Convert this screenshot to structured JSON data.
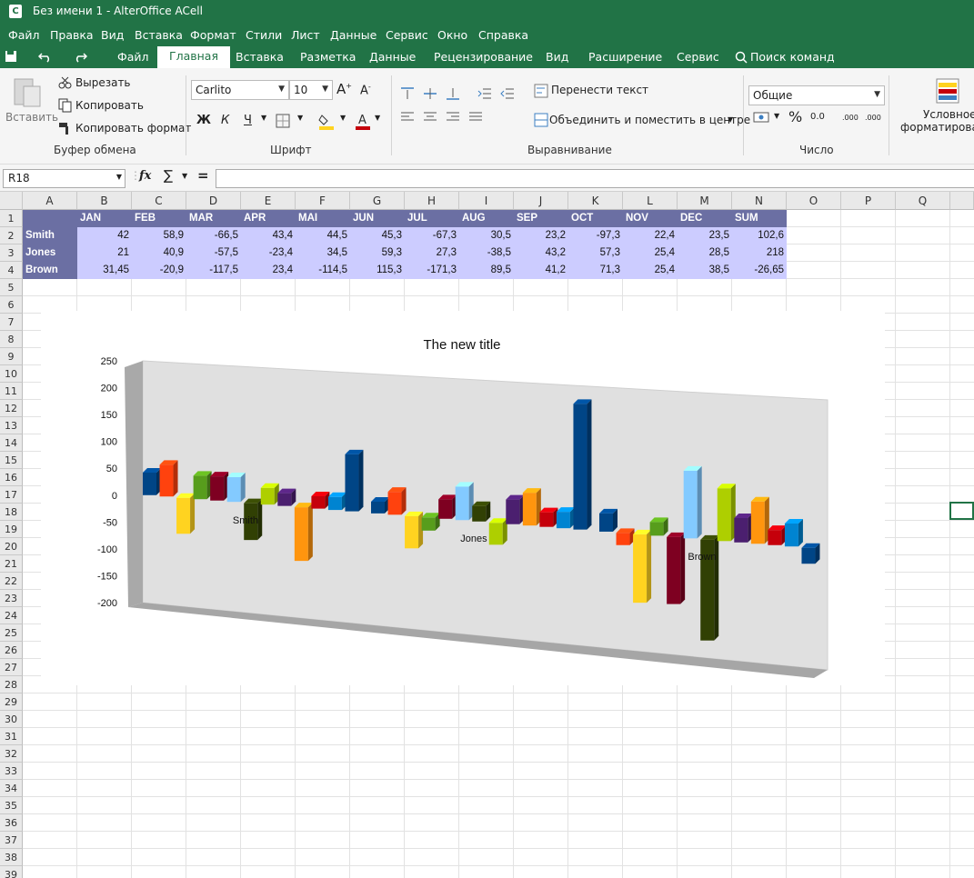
{
  "window": {
    "title": "Без имени 1 - AlterOffice ACell",
    "app_icon": "C"
  },
  "menu": [
    "Файл",
    "Правка",
    "Вид",
    "Вставка",
    "Формат",
    "Стили",
    "Лист",
    "Данные",
    "Сервис",
    "Окно",
    "Справка"
  ],
  "ribbon_tabs": [
    "Файл",
    "Главная",
    "Вставка",
    "Разметка",
    "Данные",
    "Рецензирование",
    "Вид",
    "Расширение",
    "Сервис"
  ],
  "active_tab": "Главная",
  "search_commands": "Поиск команд",
  "clipboard": {
    "paste": "Вставить",
    "cut": "Вырезать",
    "copy": "Копировать",
    "copy_format": "Копировать формат",
    "group": "Буфер обмена"
  },
  "font": {
    "name": "Carlito",
    "size": "10",
    "bold": "Ж",
    "italic": "К",
    "underline": "Ч",
    "group": "Шрифт"
  },
  "alignment": {
    "wrap": "Перенести текст",
    "merge": "Объединить и поместить в центре",
    "group": "Выравнивание"
  },
  "number": {
    "format": "Общие",
    "percent": "%",
    "decimal": "0.0",
    "inc_decimal": ".000",
    "dec_decimal": ".000",
    "group": "Число"
  },
  "conditional": {
    "line1": "Условное",
    "line2": "форматирован"
  },
  "name_box": "R18",
  "formula": "",
  "fx_label": "fx",
  "columns": [
    "A",
    "B",
    "C",
    "D",
    "E",
    "F",
    "G",
    "H",
    "I",
    "J",
    "K",
    "L",
    "M",
    "N",
    "O",
    "P",
    "Q"
  ],
  "rows": [
    "1",
    "2",
    "3",
    "4",
    "5",
    "6",
    "7",
    "8",
    "9",
    "10",
    "11",
    "12",
    "13",
    "14",
    "15",
    "16",
    "17",
    "18",
    "19",
    "20",
    "21",
    "22",
    "23",
    "24",
    "25",
    "26",
    "27",
    "28",
    "29",
    "30",
    "31",
    "32",
    "33",
    "34",
    "35",
    "36",
    "37",
    "38",
    "39"
  ],
  "table": {
    "headers": [
      "JAN",
      "FEB",
      "MAR",
      "APR",
      "MAI",
      "JUN",
      "JUL",
      "AUG",
      "SEP",
      "OCT",
      "NOV",
      "DEC",
      "SUM"
    ],
    "rows": [
      {
        "name": "Smith",
        "values": [
          "42",
          "58,9",
          "-66,5",
          "43,4",
          "44,5",
          "45,3",
          "-67,3",
          "30,5",
          "23,2",
          "-97,3",
          "22,4",
          "23,5",
          "102,6"
        ]
      },
      {
        "name": "Jones",
        "values": [
          "21",
          "40,9",
          "-57,5",
          "-23,4",
          "34,5",
          "59,3",
          "27,3",
          "-38,5",
          "43,2",
          "57,3",
          "25,4",
          "28,5",
          "218"
        ]
      },
      {
        "name": "Brown",
        "values": [
          "31,45",
          "-20,9",
          "-117,5",
          "23,4",
          "-114,5",
          "115,3",
          "-171,3",
          "89,5",
          "41,2",
          "71,3",
          "25,4",
          "38,5",
          "-26,65"
        ]
      }
    ],
    "header_color": "#6b6fa3",
    "value_color": "#ccccff"
  },
  "chart_data": {
    "type": "bar",
    "title": "The new title",
    "categories": [
      "Smith",
      "Jones",
      "Brown"
    ],
    "series": [
      {
        "values": [
          42,
          21,
          31.45
        ],
        "color": "#004586"
      },
      {
        "values": [
          58.9,
          40.9,
          -20.9
        ],
        "color": "#ff420e"
      },
      {
        "values": [
          -66.5,
          -57.5,
          -117.5
        ],
        "color": "#ffd320"
      },
      {
        "values": [
          43.4,
          -23.4,
          23.4
        ],
        "color": "#579d1c"
      },
      {
        "values": [
          44.5,
          34.5,
          -114.5
        ],
        "color": "#7e0021"
      },
      {
        "values": [
          45.3,
          59.3,
          115.3
        ],
        "color": "#83caff"
      },
      {
        "values": [
          -67.3,
          27.3,
          -171.3
        ],
        "color": "#314004"
      },
      {
        "values": [
          30.5,
          -38.5,
          89.5
        ],
        "color": "#aecf00"
      },
      {
        "values": [
          23.2,
          43.2,
          41.2
        ],
        "color": "#4b1f6f"
      },
      {
        "values": [
          -97.3,
          57.3,
          71.3
        ],
        "color": "#ff950e"
      },
      {
        "values": [
          22.4,
          25.4,
          25.4
        ],
        "color": "#c5000b"
      },
      {
        "values": [
          23.5,
          28.5,
          38.5
        ],
        "color": "#0084d1"
      },
      {
        "values": [
          102.6,
          218,
          -26.65
        ],
        "color": "#004586"
      }
    ],
    "y_ticks": [
      "250",
      "200",
      "150",
      "100",
      "50",
      "0",
      "-50",
      "-100",
      "-150",
      "-200"
    ],
    "ylim": [
      -200,
      250
    ],
    "three_d": true,
    "grid": false,
    "legend": "none"
  }
}
